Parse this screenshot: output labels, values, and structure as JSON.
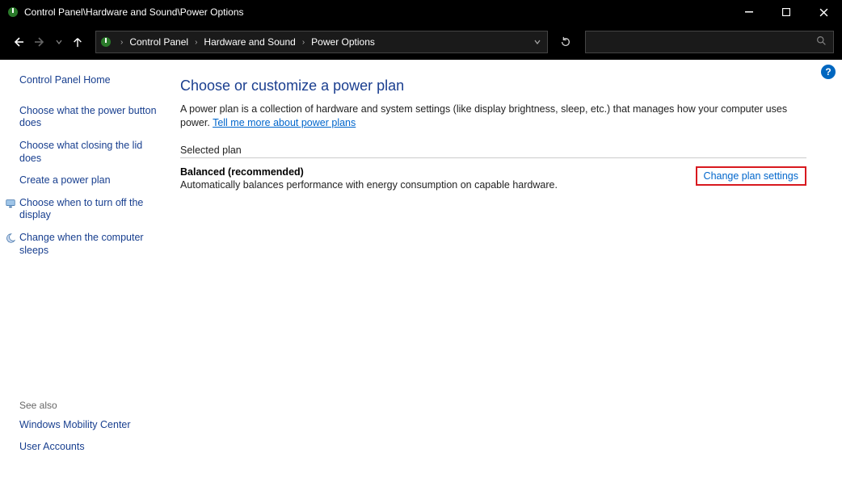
{
  "titlebar": {
    "title": "Control Panel\\Hardware and Sound\\Power Options"
  },
  "breadcrumb": {
    "seg0": "Control Panel",
    "seg1": "Hardware and Sound",
    "seg2": "Power Options"
  },
  "sidebar": {
    "home": "Control Panel Home",
    "items": {
      "i0": "Choose what the power button does",
      "i1": "Choose what closing the lid does",
      "i2": "Create a power plan",
      "i3": "Choose when to turn off the display",
      "i4": "Change when the computer sleeps"
    },
    "see_also_heading": "See also",
    "see_also": {
      "s0": "Windows Mobility Center",
      "s1": "User Accounts"
    }
  },
  "help_badge": "?",
  "main": {
    "heading": "Choose or customize a power plan",
    "desc_prefix": "A power plan is a collection of hardware and system settings (like display brightness, sleep, etc.) that manages how your computer uses power. ",
    "desc_link": "Tell me more about power plans",
    "selected_heading": "Selected plan",
    "plan_name": "Balanced (recommended)",
    "plan_sub": "Automatically balances performance with energy consumption on capable hardware.",
    "change_link": "Change plan settings"
  }
}
